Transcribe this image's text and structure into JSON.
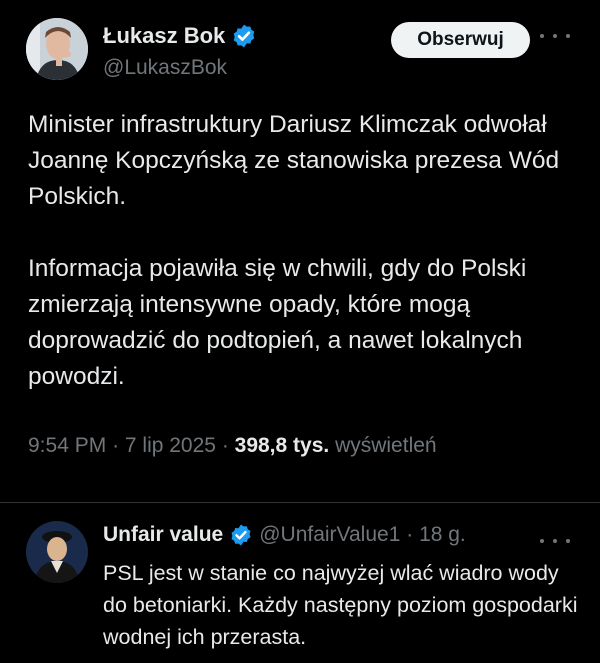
{
  "tweet": {
    "author_name": "Łukasz Bok",
    "author_handle": "@LukaszBok",
    "follow_label": "Obserwuj",
    "paragraph_1": "Minister infrastruktury Dariusz Klimczak odwołał Joannę Kopczyńską ze stanowiska prezesa Wód Polskich.",
    "paragraph_2": "Informacja pojawiła się w chwili, gdy do Polski zmierzają intensywne opady, które mogą doprowadzić do podtopień, a nawet lokalnych powodzi.",
    "time": "9:54 PM",
    "date": "7 lip 2025",
    "views_count": "398,8 tys.",
    "views_label": "wyświetleń"
  },
  "reply": {
    "author_name": "Unfair value",
    "author_handle": "@UnfairValue1",
    "age": "18 g.",
    "text": "PSL jest w stanie co najwyżej wlać wiadro wody do betoniarki. Każdy następny poziom gospodarki wodnej ich przerasta."
  },
  "colors": {
    "background": "#000000",
    "text": "#e7e9ea",
    "secondary_text": "#71767b",
    "verified_badge": "#1d9bf0",
    "follow_button_bg": "#eff3f4",
    "divider": "#2f3336"
  },
  "icons": {
    "verified": "verified-badge-icon",
    "more": "more-dots-icon"
  }
}
